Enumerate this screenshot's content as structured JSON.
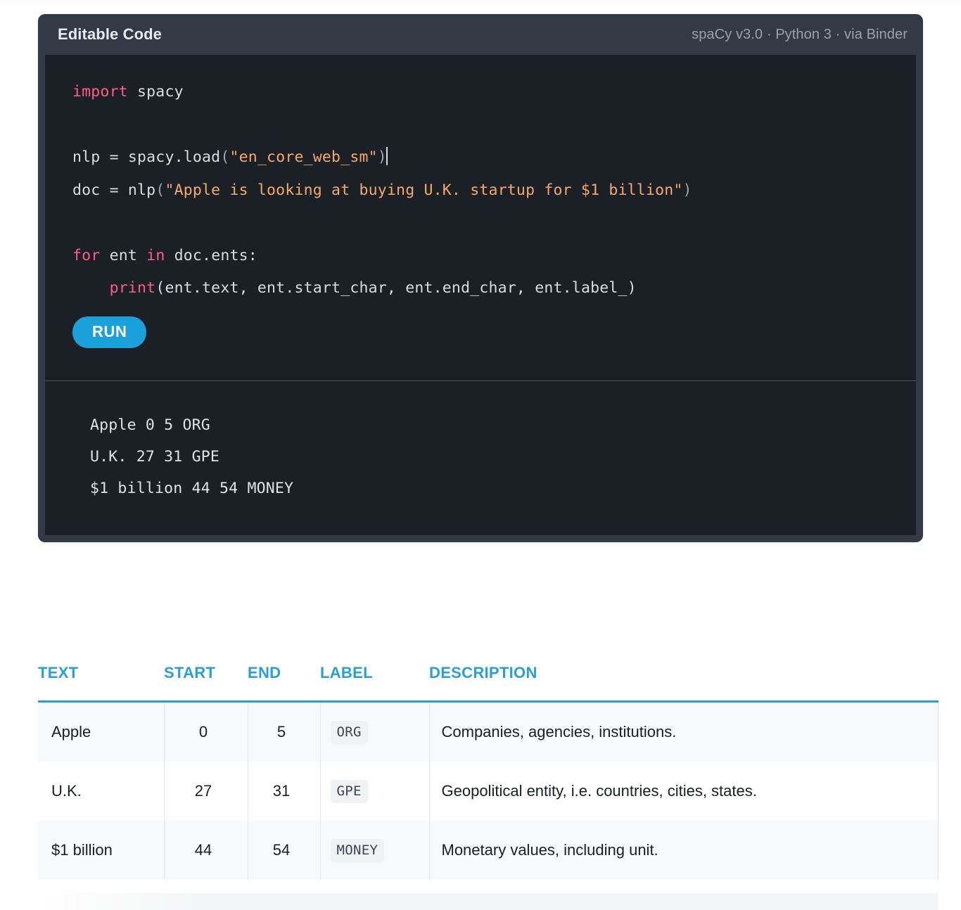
{
  "widget": {
    "title": "Editable Code",
    "meta": "spaCy v3.0 · Python 3 · via Binder",
    "run_label": "RUN",
    "code_lines": [
      "import spacy",
      "",
      "nlp = spacy.load(\"en_core_web_sm\")",
      "doc = nlp(\"Apple is looking at buying U.K. startup for $1 billion\")",
      "",
      "for ent in doc.ents:",
      "    print(ent.text, ent.start_char, ent.end_char, ent.label_)"
    ],
    "code": {
      "l1_kw": "import",
      "l1_rest": " spacy",
      "l3_name": "nlp = spacy.load",
      "l3_open": "(",
      "l3_str": "\"en_core_web_sm\"",
      "l3_close": ")",
      "l4_name": "doc = nlp",
      "l4_open": "(",
      "l4_str": "\"Apple is looking at buying U.K. startup for $1 billion\"",
      "l4_close": ")",
      "l6_for": "for",
      "l6_ent": " ent ",
      "l6_in": "in",
      "l6_rest": " doc.ents:",
      "l7_indent": "    ",
      "l7_print": "print",
      "l7_rest": "(ent.text, ent.start_char, ent.end_char, ent.label_)"
    },
    "output_lines": [
      "Apple 0 5 ORG",
      "U.K. 27 31 GPE",
      "$1 billion 44 54 MONEY"
    ]
  },
  "table": {
    "headers": {
      "text": "TEXT",
      "start": "START",
      "end": "END",
      "label": "LABEL",
      "description": "DESCRIPTION"
    },
    "rows": [
      {
        "text": "Apple",
        "start": "0",
        "end": "5",
        "label": "ORG",
        "description": "Companies, agencies, institutions."
      },
      {
        "text": "U.K.",
        "start": "27",
        "end": "31",
        "label": "GPE",
        "description": "Geopolitical entity, i.e. countries, cities, states."
      },
      {
        "text": "$1 billion",
        "start": "44",
        "end": "54",
        "label": "MONEY",
        "description": "Monetary values, including unit."
      }
    ]
  },
  "colors": {
    "accent": "#2a9fd6",
    "run_button": "#1ba0da",
    "panel": "#333a45",
    "code_bg": "#1b1f26",
    "keyword": "#ff5c8a",
    "string": "#f5a96a"
  }
}
